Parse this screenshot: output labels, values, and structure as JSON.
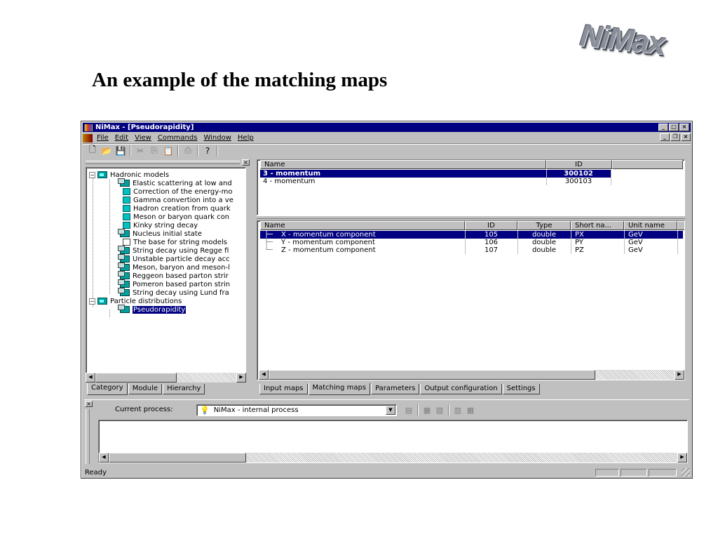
{
  "logo": "NiMax",
  "slide_title": "An example of the matching maps",
  "window": {
    "title": "NiMax - [Pseudorapidity]",
    "menu": [
      "File",
      "Edit",
      "View",
      "Commands",
      "Window",
      "Help"
    ],
    "status": "Ready"
  },
  "tree": {
    "groups": [
      {
        "label": "Hadronic models",
        "children": [
          "Elastic scattering at low and",
          "Correction of the energy-mo",
          "Gamma convertion into a ve",
          "Hadron creation from quark",
          "Meson or baryon quark con",
          "Kinky string decay",
          "Nucleus initial state",
          "The base for string models",
          "String decay using Regge fi",
          "Unstable particle decay acc",
          "Meson, baryon and meson-l",
          "Reggeon based parton strir",
          "Pomeron based parton strin",
          "String decay using Lund fra"
        ]
      },
      {
        "label": "Particle distributions",
        "children": [
          "Pseudorapidity"
        ]
      }
    ],
    "tabs": [
      "Category",
      "Module",
      "Hierarchy"
    ]
  },
  "maps_table": {
    "columns": [
      "Name",
      "ID"
    ],
    "rows": [
      [
        "3 - momentum",
        "300102"
      ],
      [
        "4 - momentum",
        "300103"
      ]
    ]
  },
  "components_table": {
    "columns": [
      "Name",
      "ID",
      "Type",
      "Short na...",
      "Unit name"
    ],
    "rows": [
      [
        "X - momentum component",
        "105",
        "double",
        "PX",
        "GeV"
      ],
      [
        "Y - momentum component",
        "106",
        "double",
        "PY",
        "GeV"
      ],
      [
        "Z - momentum component",
        "107",
        "double",
        "PZ",
        "GeV"
      ]
    ]
  },
  "right_tabs": [
    "Input maps",
    "Matching maps",
    "Parameters",
    "Output configuration",
    "Settings"
  ],
  "process": {
    "label": "Current process:",
    "value": "NiMax - internal process"
  }
}
